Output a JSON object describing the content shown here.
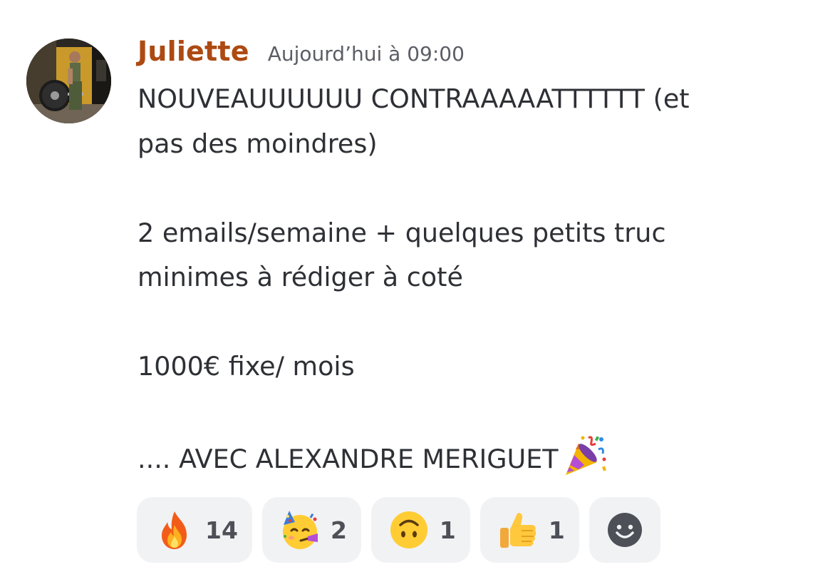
{
  "message": {
    "author": "Juliette",
    "timestamp": "Aujourd’hui à 09:00",
    "lines": [
      "NOUVEAUUUUUU CONTRAAAAATTTTTT (et",
      "pas des moindres)",
      "2 emails/semaine + quelques petits truc",
      "minimes à rédiger à coté",
      "1000€ fixe/ mois",
      ".... AVEC ALEXANDRE MERIGUET"
    ],
    "trailing_emoji": "party-popper"
  },
  "reactions": [
    {
      "emoji": "fire",
      "count": "14"
    },
    {
      "emoji": "partying-face",
      "count": "2"
    },
    {
      "emoji": "upside-down-face",
      "count": "1"
    },
    {
      "emoji": "thumbs-up",
      "count": "1"
    }
  ],
  "colors": {
    "author": "#ad4a12",
    "timestamp": "#5c5e66",
    "text": "#2e3035",
    "reaction_bg": "#f1f2f4",
    "reaction_count": "#4e5058"
  }
}
